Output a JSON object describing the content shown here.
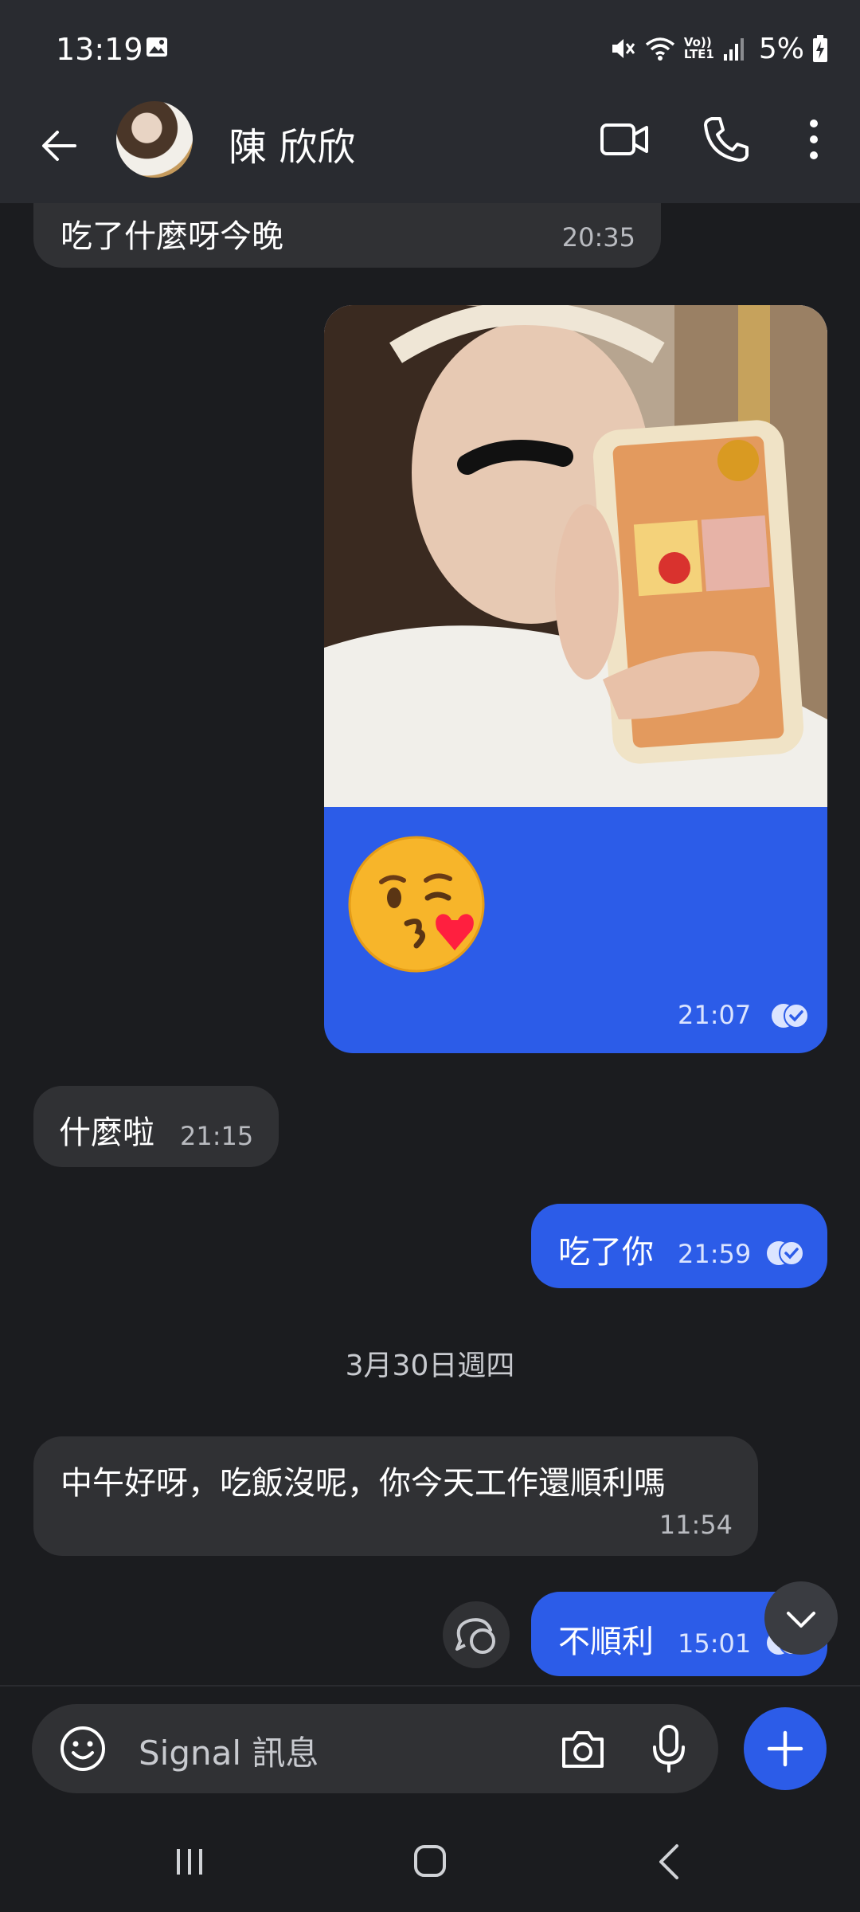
{
  "status_bar": {
    "time": "13:19",
    "battery": "5%",
    "volte_label_top": "Vo))",
    "volte_label_bottom": "LTE1"
  },
  "header": {
    "contact_name": "陳 欣欣"
  },
  "messages": [
    {
      "direction": "incoming",
      "text": "吃了什麼呀今晚",
      "time": "20:35"
    },
    {
      "direction": "outgoing",
      "type": "photo",
      "emoji": "kissing-face-with-heart",
      "time": "21:07",
      "status": "read"
    },
    {
      "direction": "incoming",
      "text": "什麼啦",
      "time": "21:15"
    },
    {
      "direction": "outgoing",
      "text": "吃了你",
      "time": "21:59",
      "status": "read"
    },
    {
      "direction": "incoming",
      "text": "中午好呀，吃飯沒呢，你今天工作還順利嗎",
      "time": "11:54"
    },
    {
      "direction": "outgoing",
      "text": "不順利",
      "time": "15:01",
      "status": "read"
    }
  ],
  "date_separator": "3月30日週四",
  "composer": {
    "placeholder": "Signal 訊息"
  },
  "colors": {
    "background": "#1b1c1f",
    "bar": "#292b30",
    "incoming_bubble": "#303134",
    "outgoing_bubble": "#2c5ce8"
  },
  "icons": {
    "back": "arrow-left-icon",
    "video": "video-camera-icon",
    "call": "phone-icon",
    "more": "more-vertical-icon",
    "emoji": "smiley-icon",
    "camera": "camera-icon",
    "mic": "microphone-icon",
    "attach": "plus-icon",
    "scroll": "chevron-down-icon",
    "react": "reaction-icon"
  }
}
